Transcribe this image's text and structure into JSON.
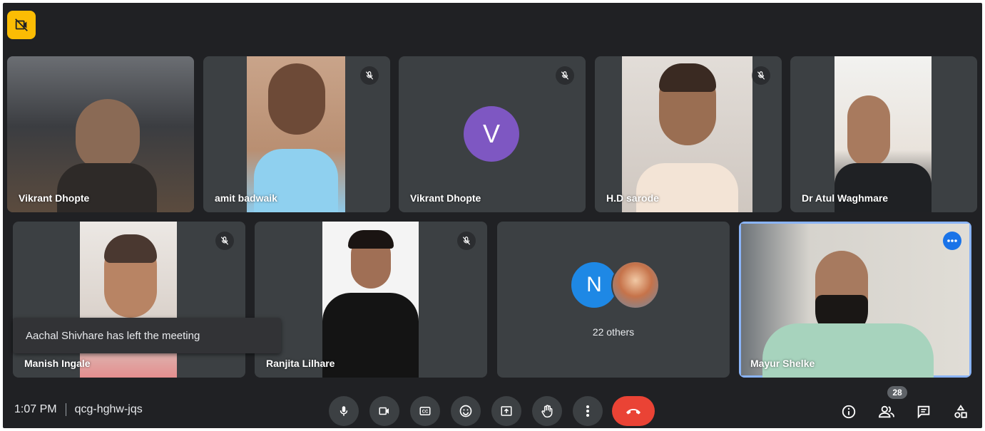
{
  "participants_row1": [
    {
      "name": "Vikrant Dhopte"
    },
    {
      "name": "amit badwaik"
    },
    {
      "name": "Vikrant Dhopte",
      "initial": "V"
    },
    {
      "name": "H.D sarode"
    },
    {
      "name": "Dr Atul Waghmare"
    }
  ],
  "participants_row2": [
    {
      "name": "Manish Ingale"
    },
    {
      "name": "Ranjita Lilhare"
    },
    {
      "initial": "N",
      "others_label": "22 others"
    },
    {
      "name": "Mayur Shelke"
    }
  ],
  "toast": {
    "text": "Aachal Shivhare has left the meeting"
  },
  "meeting": {
    "time": "1:07 PM",
    "code": "qcg-hghw-jqs"
  },
  "people_count": "28",
  "controls": [
    "microphone-icon",
    "camera-icon",
    "captions-icon",
    "emoji-icon",
    "present-icon",
    "raise-hand-icon",
    "more-options-icon",
    "hang-up-icon"
  ],
  "right_icons": [
    "info-icon",
    "people-icon",
    "chat-icon",
    "activities-icon"
  ],
  "colors": {
    "background": "#202124",
    "tile": "#3c4043",
    "avatar_v": "#7e57c2",
    "avatar_n": "#1e88e5",
    "hang_up": "#ea4335",
    "active_outline": "#8ab4f8",
    "recording": "#fbbc04"
  }
}
